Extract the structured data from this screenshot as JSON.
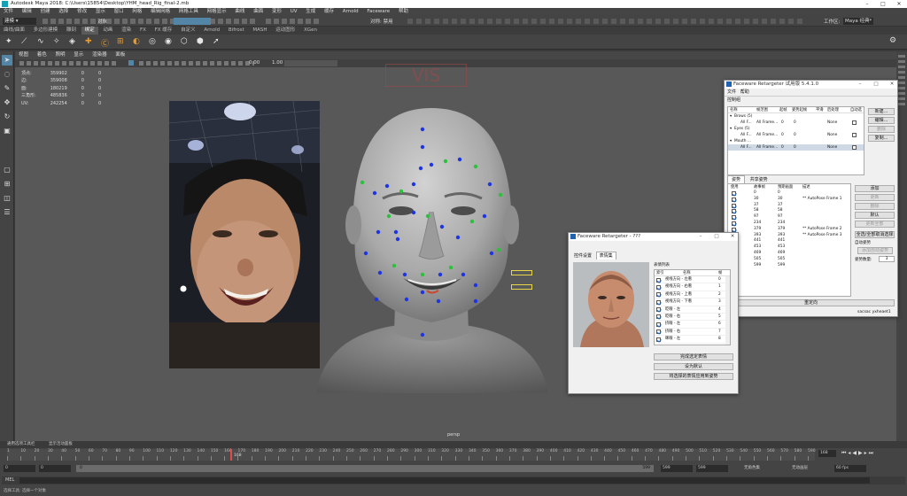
{
  "window": {
    "title": "Autodesk Maya 2018: C:\\Users\\15854\\Desktop\\YHM_head_Rig_final-2.mb"
  },
  "menubar": [
    "文件",
    "编辑",
    "创建",
    "选择",
    "修改",
    "显示",
    "窗口",
    "网格",
    "编辑网格",
    "网格工具",
    "网格显示",
    "曲线",
    "曲面",
    "变形",
    "UV",
    "生成",
    "缓存",
    "Arnold",
    "Faceware",
    "帮助"
  ],
  "statusline": {
    "mode": "建模",
    "objects_label": "对象",
    "symmetry": "对称: 禁用",
    "workspace_label": "工作区:",
    "workspace_value": "Maya 经典*"
  },
  "shelf_tabs": [
    "曲线/曲面",
    "多边形建模",
    "雕刻",
    "绑定",
    "动画",
    "渲染",
    "FX",
    "FX 缓存",
    "自定义",
    "Arnold",
    "Bifrost",
    "MASH",
    "运动图形",
    "XGen"
  ],
  "shelf_active": "绑定",
  "viewport": {
    "menu": [
      "视图",
      "着色",
      "照明",
      "显示",
      "渲染器",
      "面板"
    ],
    "hud": {
      "rows": [
        [
          "顶点:",
          "359902",
          "0",
          "0"
        ],
        [
          "边:",
          "359008",
          "0",
          "0"
        ],
        [
          "面:",
          "180219",
          "0",
          "0"
        ],
        [
          "三角形:",
          "485836",
          "0",
          "0"
        ],
        [
          "UV:",
          "242254",
          "0",
          "0"
        ]
      ]
    },
    "exposure": "0.00",
    "gamma": "1.00",
    "camera_label": "persp",
    "bg_logo": "VIS"
  },
  "retargeter": {
    "title": "Faceware Retargeter 试用版 5.4.1.0",
    "menu": [
      "文件",
      "帮助"
    ],
    "group_title": "控制组",
    "columns": [
      "名称",
      "帧范围",
      "起帧",
      "姿势起帧",
      "平滑",
      "后处理",
      "自动选"
    ],
    "rows": [
      {
        "name": "Brows (5)",
        "type": "group"
      },
      {
        "name": "All F...",
        "range": "All Frame...",
        "a": "0",
        "b": "0",
        "c": "None",
        "type": "item"
      },
      {
        "name": "Eyes (5)",
        "type": "group"
      },
      {
        "name": "All F...",
        "range": "All Frame...",
        "a": "0",
        "b": "0",
        "c": "None",
        "type": "item"
      },
      {
        "name": "Mouth ...",
        "type": "group"
      },
      {
        "name": "All F...",
        "range": "All Frame...",
        "a": "0",
        "b": "0",
        "c": "None",
        "type": "item"
      }
    ],
    "side_buttons": [
      "新建...",
      "编辑...",
      "删除",
      "复制..."
    ],
    "tabs": [
      "姿势",
      "共享姿势"
    ],
    "pose_columns": [
      "使用",
      "故事帧",
      "预期画面",
      "描述"
    ],
    "poses": [
      {
        "story": "0",
        "pose": "0",
        "desc": ""
      },
      {
        "story": "30",
        "pose": "30",
        "desc": "** AutoPose Frame 1"
      },
      {
        "story": "37",
        "pose": "37",
        "desc": ""
      },
      {
        "story": "58",
        "pose": "58",
        "desc": ""
      },
      {
        "story": "97",
        "pose": "97",
        "desc": ""
      },
      {
        "story": "234",
        "pose": "234",
        "desc": ""
      },
      {
        "story": "379",
        "pose": "379",
        "desc": "** AutoPose Frame 2"
      },
      {
        "story": "393",
        "pose": "393",
        "desc": "** AutoPose Frame 3"
      },
      {
        "story": "441",
        "pose": "441",
        "desc": ""
      },
      {
        "story": "453",
        "pose": "453",
        "desc": ""
      },
      {
        "story": "469",
        "pose": "469",
        "desc": ""
      },
      {
        "story": "505",
        "pose": "505",
        "desc": ""
      },
      {
        "story": "599",
        "pose": "599",
        "desc": ""
      }
    ],
    "pose_buttons": [
      "添加",
      "更新",
      "删除",
      "默认",
      "更新全部"
    ],
    "pose_buttons2": [
      "全选/全部取消选择"
    ],
    "auto_label": "自动姿势",
    "auto_btn": "添加自动姿势",
    "auto_count_label": "姿势数量:",
    "auto_count": "3",
    "retarget_btn": "重定向",
    "status": "sacsac  yxheaet1"
  },
  "expr": {
    "title": "Faceware Retargeter - ???",
    "tabs": [
      "控件设置",
      "表情集"
    ],
    "list_title": "表情列表",
    "columns": [
      "索引",
      "名称",
      "帧"
    ],
    "rows": [
      {
        "name": "视线方向 - 左看",
        "frame": "0"
      },
      {
        "name": "视线方向 - 右看",
        "frame": "1"
      },
      {
        "name": "视线方向 - 上看",
        "frame": "2"
      },
      {
        "name": "视线方向 - 下看",
        "frame": "3"
      },
      {
        "name": "眨眼 - 左",
        "frame": "4"
      },
      {
        "name": "眨眼 - 右",
        "frame": "5"
      },
      {
        "name": "挤眼 - 左",
        "frame": "6"
      },
      {
        "name": "挤眼 - 右",
        "frame": "7"
      },
      {
        "name": "眯眼 - 左",
        "frame": "8"
      }
    ],
    "buttons": [
      "完成选定表情",
      "设为默认",
      "将选择的表情应用到姿势"
    ]
  },
  "timeline": {
    "ticks": [
      "1",
      "10",
      "20",
      "30",
      "40",
      "50",
      "60",
      "70",
      "80",
      "90",
      "100",
      "110",
      "120",
      "130",
      "140",
      "150",
      "160",
      "170",
      "180",
      "190",
      "200",
      "210",
      "220",
      "230",
      "240",
      "250",
      "260",
      "270",
      "280",
      "290",
      "300",
      "310",
      "320",
      "330",
      "340",
      "350",
      "360",
      "370",
      "380",
      "390",
      "400",
      "410",
      "420",
      "430",
      "440",
      "450",
      "460",
      "470",
      "480",
      "490",
      "500",
      "510",
      "520",
      "530",
      "540",
      "550",
      "560",
      "570",
      "580",
      "590"
    ],
    "current_frame": "168",
    "current_frame_box": "168",
    "start": "0",
    "start2": "0",
    "range_start": "0",
    "range_end": "599",
    "end": "599",
    "end2": "599",
    "char_set": "无角色集",
    "anim_layer": "无动画层",
    "fps": "60 fps",
    "mel_label": "MEL",
    "tabs": [
      "通用选项工具栏",
      "显示活动面板"
    ],
    "help": "选择工具: 选择一个对象"
  },
  "colors": {
    "dot_blue": "#1d35e6",
    "dot_green": "#28c23b",
    "maya_teal": "#18a0b5",
    "highlight": "#5285a6"
  }
}
